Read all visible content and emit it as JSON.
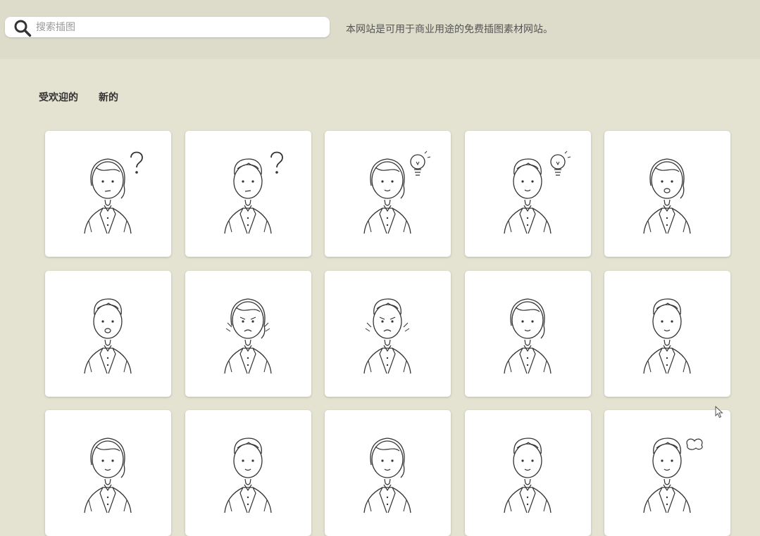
{
  "search": {
    "placeholder": "搜索插图",
    "value": ""
  },
  "header": {
    "tagline": "本网站是可用于商业用途的免费插图素材网站。"
  },
  "tabs": [
    {
      "label": "受欢迎的"
    },
    {
      "label": "新的"
    }
  ],
  "gallery": {
    "items": [
      {
        "icon": "woman-question-icon",
        "gender": "woman",
        "mood": "confused",
        "prop": "question"
      },
      {
        "icon": "man-question-icon",
        "gender": "man",
        "mood": "confused",
        "prop": "question"
      },
      {
        "icon": "woman-idea-icon",
        "gender": "woman",
        "mood": "happy",
        "prop": "bulb"
      },
      {
        "icon": "man-idea-icon",
        "gender": "man",
        "mood": "happy",
        "prop": "bulb"
      },
      {
        "icon": "woman-worried-icon",
        "gender": "woman",
        "mood": "worried",
        "prop": "none"
      },
      {
        "icon": "man-surprised-icon",
        "gender": "man",
        "mood": "surprised",
        "prop": "none"
      },
      {
        "icon": "woman-angry-icon",
        "gender": "woman",
        "mood": "angry",
        "prop": "anger"
      },
      {
        "icon": "man-angry-icon",
        "gender": "man",
        "mood": "angry",
        "prop": "anger"
      },
      {
        "icon": "woman-calm-icon",
        "gender": "woman",
        "mood": "calm",
        "prop": "none"
      },
      {
        "icon": "man-calm-icon",
        "gender": "man",
        "mood": "calm",
        "prop": "none"
      },
      {
        "icon": "woman-partial-icon",
        "gender": "woman",
        "mood": "calm",
        "prop": "none"
      },
      {
        "icon": "man-partial-icon",
        "gender": "man",
        "mood": "calm",
        "prop": "none"
      },
      {
        "icon": "woman-partial-icon",
        "gender": "woman",
        "mood": "calm",
        "prop": "none"
      },
      {
        "icon": "man-partial-icon",
        "gender": "man",
        "mood": "calm",
        "prop": "none"
      },
      {
        "icon": "man-thought-icon",
        "gender": "man",
        "mood": "calm",
        "prop": "cloud"
      }
    ]
  },
  "colors": {
    "background": "#e4e2d0",
    "header": "#dddbca",
    "card": "#ffffff",
    "line": "#333333"
  }
}
